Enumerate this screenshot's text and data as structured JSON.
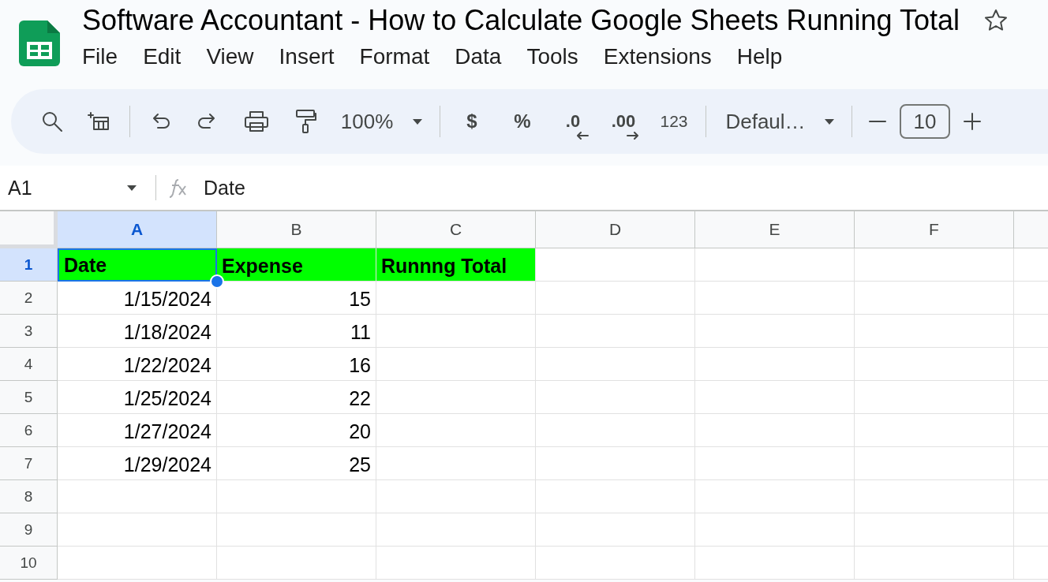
{
  "document": {
    "title": "Software Accountant - How to Calculate Google Sheets Running Total"
  },
  "menu": [
    "File",
    "Edit",
    "View",
    "Insert",
    "Format",
    "Data",
    "Tools",
    "Extensions",
    "Help"
  ],
  "toolbar": {
    "zoom": "100%",
    "currency": "$",
    "percent": "%",
    "decrease_decimal": ".0",
    "increase_decimal": ".00",
    "number_format": "123",
    "font": "Defaul…",
    "font_size": "10"
  },
  "formula_bar": {
    "name_box": "A1",
    "formula": "Date"
  },
  "columns": [
    {
      "label": "A",
      "selected": true
    },
    {
      "label": "B",
      "selected": false
    },
    {
      "label": "C",
      "selected": false
    },
    {
      "label": "D",
      "selected": false
    },
    {
      "label": "E",
      "selected": false
    },
    {
      "label": "F",
      "selected": false
    }
  ],
  "rows": [
    {
      "number": "1",
      "selected": true,
      "cells": [
        {
          "text": "Date",
          "kind": "heading",
          "selected": true
        },
        {
          "text": "Expense",
          "kind": "heading",
          "selected": false
        },
        {
          "text": "Runnng Total",
          "kind": "heading",
          "selected": false
        }
      ]
    },
    {
      "number": "2",
      "selected": false,
      "cells": [
        {
          "text": "1/15/2024",
          "kind": "number",
          "selected": false
        },
        {
          "text": "15",
          "kind": "number",
          "selected": false
        }
      ]
    },
    {
      "number": "3",
      "selected": false,
      "cells": [
        {
          "text": "1/18/2024",
          "kind": "number",
          "selected": false
        },
        {
          "text": "11",
          "kind": "number",
          "selected": false
        }
      ]
    },
    {
      "number": "4",
      "selected": false,
      "cells": [
        {
          "text": "1/22/2024",
          "kind": "number",
          "selected": false
        },
        {
          "text": "16",
          "kind": "number",
          "selected": false
        }
      ]
    },
    {
      "number": "5",
      "selected": false,
      "cells": [
        {
          "text": "1/25/2024",
          "kind": "number",
          "selected": false
        },
        {
          "text": "22",
          "kind": "number",
          "selected": false
        }
      ]
    },
    {
      "number": "6",
      "selected": false,
      "cells": [
        {
          "text": "1/27/2024",
          "kind": "number",
          "selected": false
        },
        {
          "text": "20",
          "kind": "number",
          "selected": false
        }
      ]
    },
    {
      "number": "7",
      "selected": false,
      "cells": [
        {
          "text": "1/29/2024",
          "kind": "number",
          "selected": false
        },
        {
          "text": "25",
          "kind": "number",
          "selected": false
        }
      ]
    },
    {
      "number": "8",
      "selected": false,
      "cells": []
    },
    {
      "number": "9",
      "selected": false,
      "cells": []
    },
    {
      "number": "10",
      "selected": false,
      "cells": []
    }
  ]
}
